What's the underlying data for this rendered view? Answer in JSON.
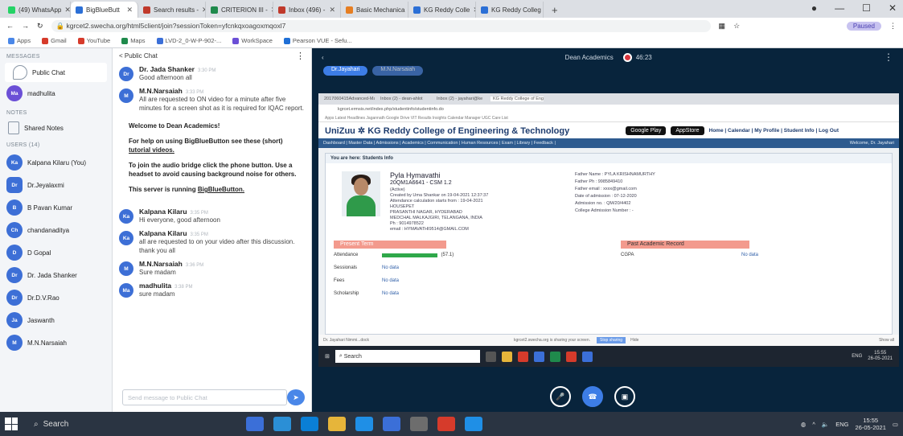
{
  "browser": {
    "tabs": [
      {
        "label": "(49) WhatsApp",
        "color": "#25d366"
      },
      {
        "label": "BigBlueButt",
        "color": "#2b6fd6",
        "active": true
      },
      {
        "label": "Search results -",
        "color": "#c0392b"
      },
      {
        "label": "CRITERION III -",
        "color": "#1f8a4c"
      },
      {
        "label": "Inbox (496) -",
        "color": "#c0392b"
      },
      {
        "label": "Basic Mechanica",
        "color": "#e67e22"
      },
      {
        "label": "KG Reddy Colle",
        "color": "#2b6fd6"
      },
      {
        "label": "KG Reddy Colleg",
        "color": "#2b6fd6"
      }
    ],
    "url": "kgrcet2.swecha.org/html5client/join?sessionToken=yfcnkqxoagoxmqoxl7",
    "paused_label": "Paused",
    "bookmarks": [
      "Apps",
      "Gmail",
      "YouTube",
      "Maps",
      "LVD-2_0-W-P-902-...",
      "WorkSpace",
      "Pearson VUE - Sefu..."
    ]
  },
  "sidebar": {
    "messages_title": "MESSAGES",
    "public_chat": "Public Chat",
    "madhulita": {
      "initials": "Ma",
      "name": "madhulita"
    },
    "notes_title": "NOTES",
    "shared_notes": "Shared Notes",
    "users_title": "USERS (14)",
    "users": [
      {
        "initials": "Ka",
        "name": "Kalpana Kilaru (You)",
        "color": "#3d6fd6"
      },
      {
        "initials": "Dr",
        "name": "Dr.Jeyalaxmi",
        "color": "#3d6fd6",
        "square": true
      },
      {
        "initials": "B",
        "name": "B Pavan Kumar",
        "color": "#3d6fd6"
      },
      {
        "initials": "Ch",
        "name": "chandanaditya",
        "color": "#3d6fd6"
      },
      {
        "initials": "D",
        "name": "D Gopal",
        "color": "#3d6fd6"
      },
      {
        "initials": "Dr",
        "name": "Dr. Jada Shanker",
        "color": "#3d6fd6"
      },
      {
        "initials": "Dr",
        "name": "Dr.D.V.Rao",
        "color": "#3d6fd6"
      },
      {
        "initials": "Ja",
        "name": "Jaswanth",
        "color": "#3d6fd6"
      },
      {
        "initials": "M",
        "name": "M.N.Narsaiah",
        "color": "#3d6fd6"
      }
    ]
  },
  "chat": {
    "header": "< Public Chat",
    "messages_top": [
      {
        "initials": "Dr",
        "name": "Dr. Jada Shanker",
        "time": "3:30 PM",
        "text": "Good afternoon all"
      },
      {
        "initials": "M",
        "name": "M.N.Narsaiah",
        "time": "3:33 PM",
        "text": "All are requested to ON video for a minute after five minutes for a screen shot as it is required for IQAC report."
      }
    ],
    "welcome": {
      "line1": "Welcome to Dean Academics!",
      "line2_pre": "For help on using BigBlueButton see these (short) ",
      "line2_link": "tutorial videos.",
      "line3": "To join the audio bridge click the phone button. Use a headset to avoid causing background noise for others.",
      "line4_pre": "This server is running ",
      "line4_link": "BigBlueButton."
    },
    "messages_bottom": [
      {
        "initials": "Ka",
        "name": "Kalpana Kilaru",
        "time": "3:35 PM",
        "text": "Hi everyone, good afternoon"
      },
      {
        "initials": "Ka",
        "name": "Kalpana Kilaru",
        "time": "3:35 PM",
        "text": "all are requested to on your video after this discussion. thank you all"
      },
      {
        "initials": "M",
        "name": "M.N.Narsaiah",
        "time": "3:36 PM",
        "text": "Sure madam"
      },
      {
        "initials": "Ma",
        "name": "madhulita",
        "time": "3:38 PM",
        "text": "sure madam"
      }
    ],
    "input_placeholder": "Send message to Public Chat",
    "send_icon": "send-icon"
  },
  "presentation": {
    "title": "Dean Academics",
    "record_time": "46:23",
    "talking": [
      "Dr.Jayahari",
      "M.N.Narsaiah"
    ],
    "shared_screen": {
      "tabs": [
        "2017060415Advanced-Man",
        "Inbox (2) - dean-ahlot",
        "Inbox (2) - jayahari@ke",
        "KG Reddy College of Eng"
      ],
      "url": "kgrcet.ermsis.net/index.php/studentinfo/studentinfo.do",
      "bookmarks": "Apps  Latest Headlines  Jagannath  Google Drive  VIT Results  Insights  Calendar Manager  UGC Care List",
      "brand": "UniZuu ✲ KG Reddy College of Engineering & Technology",
      "store1": "Google Play",
      "store2": "AppStore",
      "links": "Home | Calendar | My Profile | Student Info | Log Out",
      "menu": "Dashboard | Master Data | Admissions | Academics | Communication | Human Resources | Exam | Library | Feedback |",
      "welcome_user": "Welcome, Dr. Jayahari",
      "breadcrumb": "You are here: Students Info",
      "student": {
        "name": "Pyla Hymavathi",
        "id": "20QM1A6641 - CSM 1.2",
        "status": "(Active)",
        "created": "Created by Uma Shankar on 19-04-2021 12:37:37",
        "attendance_from": "Attendance calculation starts from : 19-04-2021",
        "address1": "HOUSEPET",
        "address2": "PRASANTHI NAGAR, HYDERABAD",
        "address3": "MEDCHAL MALKAJGIRI, TELANGANA, INDIA",
        "phone": "Ph : 9014978522",
        "email": "email : HYMAVATHI9514@GMAIL.COM"
      },
      "family": {
        "father_name": "Father Name : PYLA KRISHNAMURTHY",
        "father_ph": "Father Ph : 9985849410",
        "father_email": "Father email : xxxx@gmail.com",
        "doa": "Date of admission : 07-12-2020",
        "admission_no": "Admission no. : QM/20/4402",
        "college_no": "College Admission Number : -"
      },
      "present_term": "Present Term",
      "past_record": "Past Academic Record",
      "attendance_label": "Attendance",
      "attendance_value": "(57.1)",
      "attendance_fraction": 0.571,
      "sessionals_label": "Sessionals",
      "fees_label": "Fees",
      "scholarship_label": "Scholarship",
      "no_data": "No data",
      "cgpa_label": "CGPA",
      "share_text": "Dr. Jayahari Nimmi...dock",
      "sharing_notice": "kgrcet2.swecha.org is sharing your screen.",
      "stop_sharing": "Stop sharing",
      "hide": "Hide",
      "show_all": "Show all",
      "search_label": "Search",
      "tray_lang": "ENG",
      "tray_time": "15:55",
      "tray_date": "26-05-2021"
    }
  },
  "taskbar": {
    "search_label": "Search",
    "apps": [
      "#3b6fd8",
      "#2b8fd6",
      "#0a7fd6",
      "#e6b53a",
      "#1f8fe6",
      "#3b6fd8",
      "#6d6d6d",
      "#d63b2b",
      "#1f8fe6"
    ],
    "lang": "ENG",
    "time": "15:55",
    "date": "26-05-2021"
  }
}
